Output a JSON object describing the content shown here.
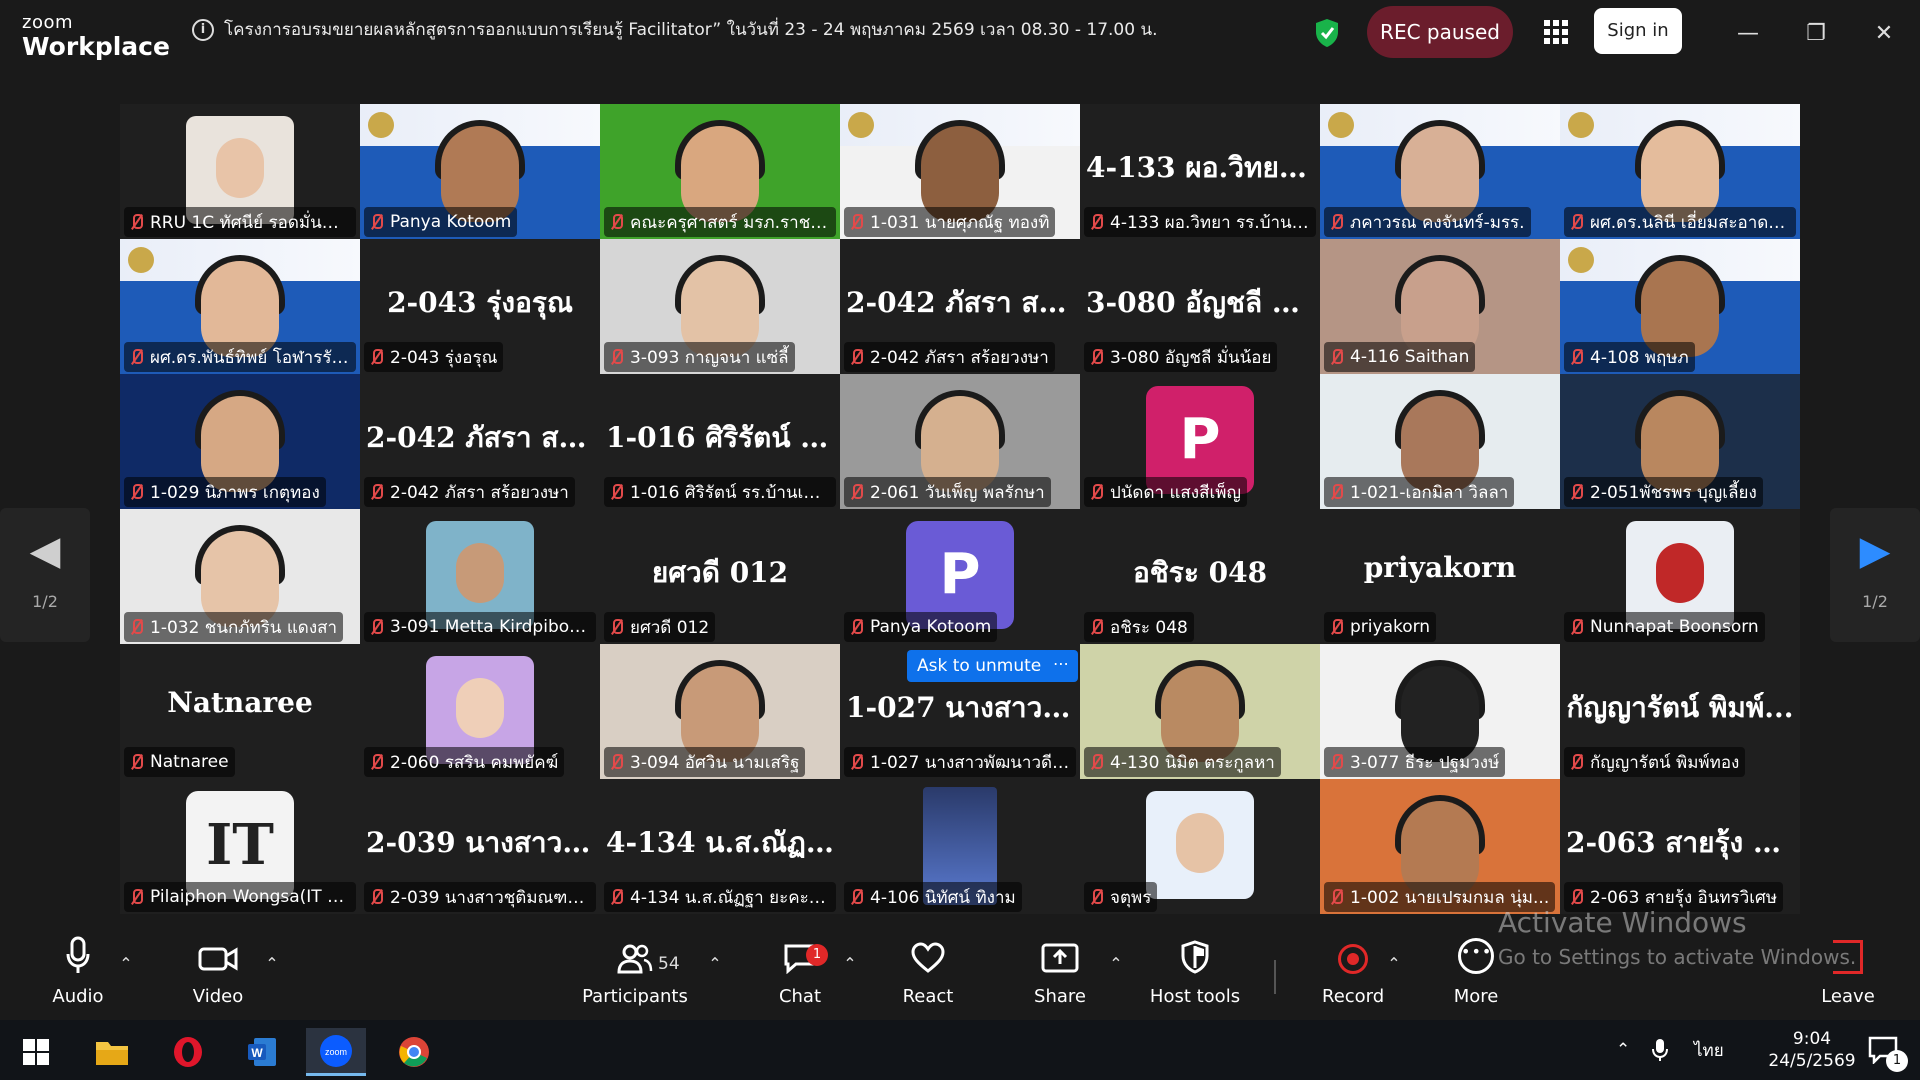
{
  "app": {
    "logo_line1": "zoom",
    "logo_line2": "Workplace"
  },
  "meeting": {
    "title": "โครงการอบรมขยายผลหลักสูตรการออกแบบการเรียนรู้ Facilitator” ในวันที่ 23 - 24 พฤษภาคม 2569 เวลา 08.30 - 17.00 น."
  },
  "header": {
    "rec_status": "REC paused",
    "sign_in": "Sign in"
  },
  "tiles": [
    {
      "type": "thumb",
      "label": "RRU 1C ทัศนีย์ รอดมั่นคง ...",
      "bg": "#e9e3dc",
      "skin": "#e8c4a8"
    },
    {
      "type": "banner",
      "label": "Panya Kotoom",
      "bg": "#1e5bb8",
      "skin": "#b07a55"
    },
    {
      "type": "video",
      "label": "คณะครุศาสตร์ มรภ.ราชนครินทร์",
      "bg": "#3fa32a",
      "skin": "#d9a77f"
    },
    {
      "type": "banner",
      "label": "1-031 นายศุภณัฐ ทองทิ",
      "bg": "#f2f2f2",
      "skin": "#8d5f3f"
    },
    {
      "type": "bigname",
      "big": "4-133 ผอ.วิทยา...",
      "label": "4-133 ผอ.วิทยา รร.บ้านเข..."
    },
    {
      "type": "banner",
      "label": "ภคาวรณ คงจันทร์-มรร.",
      "bg": "#1e5bb8",
      "skin": "#d8b096",
      "active": true
    },
    {
      "type": "banner",
      "label": "ผศ.ดร.นลินี เอี่ยมสะอาด_ม...",
      "bg": "#1e5bb8",
      "skin": "#e4bc9c"
    },
    {
      "type": "banner",
      "label": "ผศ.ดร.พันธ์ทิพย์ โอฬารรัต...",
      "bg": "#1e5bb8",
      "skin": "#e2b898"
    },
    {
      "type": "bigname",
      "big": "2-043 รุ่งอรุณ",
      "label": "2-043 รุ่งอรุณ"
    },
    {
      "type": "video",
      "label": "3-093 กาญจนา แซ่ลี้",
      "bg": "#d6d6d6",
      "skin": "#e3c2a6"
    },
    {
      "type": "bigname",
      "big": "2-042 ภัสรา สร้อ...",
      "label": "2-042 ภัสรา สร้อยวงษา"
    },
    {
      "type": "bigname",
      "big": "3-080 อัญชลี มั่น...",
      "label": "3-080 อัญชลี มั่นน้อย"
    },
    {
      "type": "video",
      "label": "4-116 Saithan",
      "bg": "#b59585",
      "skin": "#c8a08c"
    },
    {
      "type": "banner",
      "label": "4-108 พฤษภ",
      "bg": "#1e5bb8",
      "skin": "#a97550"
    },
    {
      "type": "video",
      "label": "1-029 นิภาพร เกตุทอง",
      "bg": "#0f2a66",
      "skin": "#d6a884"
    },
    {
      "type": "bigname",
      "big": "2-042 ภัสรา สร้อ...",
      "label": "2-042 ภัสรา สร้อยวงษา"
    },
    {
      "type": "bigname",
      "big": "1-016 ศิริรัตน์ รร....",
      "label": "1-016 ศิริรัตน์ รร.บ้านเขา..."
    },
    {
      "type": "video",
      "label": "2-061 วันเพ็ญ พลรักษา",
      "bg": "#9a9a9a",
      "skin": "#d5b08f"
    },
    {
      "type": "letter",
      "letter": "P",
      "label": "ปนัดดา แสงสีเพ็ญ",
      "bg": "#d0206a"
    },
    {
      "type": "video",
      "label": "1-021-เอกมิลา วิลลา",
      "bg": "#e6ecef",
      "skin": "#a9785b"
    },
    {
      "type": "video",
      "label": "2-051พัชรพร บุญเลี้ยง",
      "bg": "#1c2f4a",
      "skin": "#b9875f"
    },
    {
      "type": "video",
      "label": "1-032 ชนกภัทริน แดงสา",
      "bg": "#e8e8e8",
      "skin": "#e6c4a8"
    },
    {
      "type": "thumb",
      "label": "3-091 Metta Kirdpiboon",
      "bg": "#7fb3c9",
      "skin": "#c79a78"
    },
    {
      "type": "bigname",
      "big": "ยศวดี 012",
      "label": "ยศวดี 012"
    },
    {
      "type": "letter",
      "letter": "P",
      "label": "Panya Kotoom",
      "bg": "#6a5bd6"
    },
    {
      "type": "bigname",
      "big": "อชิระ 048",
      "label": "อชิระ 048"
    },
    {
      "type": "bigname",
      "big": "priyakorn",
      "label": "priyakorn"
    },
    {
      "type": "thumb",
      "label": "Nunnapat Boonsorn",
      "bg": "#eaeef3",
      "skin": "#c02828"
    },
    {
      "type": "bigname",
      "big": "Natnaree",
      "label": "Natnaree"
    },
    {
      "type": "thumb",
      "label": "2-060 รสริน คมพยัคฆ์",
      "bg": "#c7a5e6",
      "skin": "#efcfb8"
    },
    {
      "type": "video",
      "label": "3-094 อัศวิน นามเสริฐ",
      "bg": "#d9cfc4",
      "skin": "#c89a78"
    },
    {
      "type": "bigname",
      "big": "1-027 นางสาวพั...",
      "label": "1-027 นางสาวพัฒนาวดี ..."
    },
    {
      "type": "video",
      "label": "4-130 นิมิต ตระกูลหา",
      "bg": "#cfd3a8",
      "skin": "#b98a62"
    },
    {
      "type": "video",
      "label": "3-077 ธีระ ปฐมวงษ์",
      "bg": "#f2f2f2",
      "skin": "#222222"
    },
    {
      "type": "bigname",
      "big": "กัญญารัตน์ พิมพ์...",
      "label": "กัญญารัตน์ พิมพ์ทอง"
    },
    {
      "type": "logo",
      "logo_text": "IT",
      "label": "Pilaiphon Wongsa(IT S..."
    },
    {
      "type": "bigname",
      "big": "2-039 นางสาวชุ...",
      "label": "2-039 นางสาวชุติมณฑน์ ..."
    },
    {
      "type": "bigname",
      "big": "4-134 น.ส.ณัฏฐา...",
      "label": "4-134 น.ส.ณัฏฐา ยะคะเร..."
    },
    {
      "type": "phone",
      "label": "4-106 นิทัศน์ ทิงาม",
      "bg": "#2a3a6a",
      "skin": "#5a7ad0"
    },
    {
      "type": "thumb",
      "label": "จตุพร",
      "bg": "#e8f0fa",
      "skin": "#e6c3a6"
    },
    {
      "type": "video",
      "label": "1-002 นายเปรมกมล นุ่ม...",
      "bg": "#d9733a",
      "skin": "#b47a52"
    },
    {
      "type": "bigname",
      "big": "2-063 สายรุ้ง อิน...",
      "label": "2-063 สายรุ้ง อินทรวิเศษ"
    }
  ],
  "overlay": {
    "ask_unmute": "Ask to unmute",
    "more": "⋯"
  },
  "pager": {
    "left_icon": "prev-page-icon",
    "right_icon": "next-page-icon",
    "page": "1/2"
  },
  "watermark": {
    "line1": "Activate Windows",
    "line2": "Go to Settings to activate Windows."
  },
  "toolbar": {
    "audio": "Audio",
    "video": "Video",
    "participants": "Participants",
    "participants_count": "54",
    "chat": "Chat",
    "chat_badge": "1",
    "react": "React",
    "share": "Share",
    "host_tools": "Host tools",
    "record": "Record",
    "more": "More",
    "leave": "Leave"
  },
  "taskbar": {
    "lang": "ไทย",
    "time": "9:04",
    "date": "24/5/2569",
    "notif": "1"
  },
  "colors": {
    "accent": "#0e71eb",
    "rec": "#6b1d2c",
    "active_speaker": "#19d36a",
    "muted": "#e24a4a"
  }
}
